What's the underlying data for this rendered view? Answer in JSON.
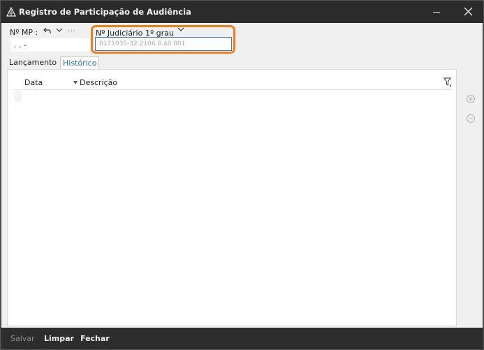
{
  "window": {
    "title": "Registro de Participação de Audiência"
  },
  "header": {
    "mp_label": "Nº MP :",
    "mp_value": ".   .     -",
    "more_dots": "···",
    "judicial_label": "Nº Judiciário",
    "judicial_degree": "1º grau",
    "judicial_value": "0171035-32.2106.0.40.001"
  },
  "tabs": [
    {
      "label": "Lançamento"
    },
    {
      "label": "Histórico"
    }
  ],
  "grid": {
    "columns": [
      {
        "label": "Data"
      },
      {
        "label": "Descrição"
      }
    ]
  },
  "footer": {
    "save_label": "Salvar",
    "clear_label": "Limpar",
    "close_label": "Fechar"
  },
  "colors": {
    "highlight": "#f07f1a",
    "active_tab": "#1a6fc9",
    "titlebar": "#2b2b2b"
  },
  "icons": [
    "app-logo-icon",
    "minimize-icon",
    "close-icon",
    "undo-icon",
    "chevron-down-icon",
    "filter-icon",
    "add-circle-icon",
    "remove-circle-icon"
  ]
}
